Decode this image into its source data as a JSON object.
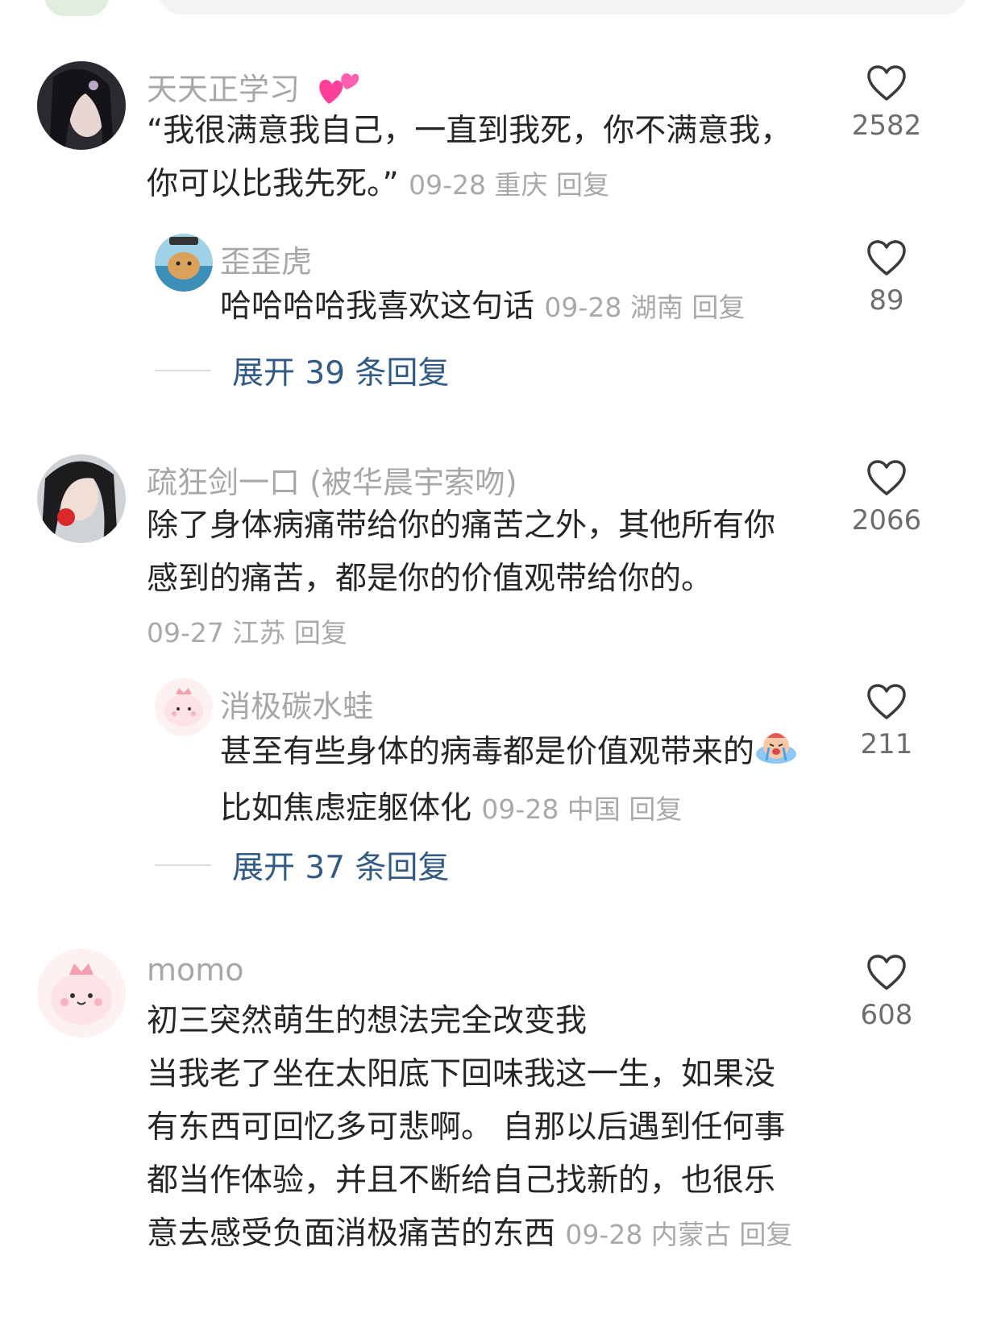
{
  "comments": [
    {
      "username": "天天正学习",
      "text_lines": [
        "“我很满意我自己，一直到我死，你不满意我，",
        "你可以比我先死。”"
      ],
      "date": "09-28",
      "location": "重庆",
      "reply_label": "回复",
      "likes": "2582",
      "sub_reply": {
        "username": "歪歪虎",
        "text": "哈哈哈哈我喜欢这句话",
        "date": "09-28",
        "location": "湖南",
        "reply_label": "回复",
        "likes": "89"
      },
      "expand_label": "展开 39 条回复"
    },
    {
      "username": "疏狂剑一口 (被华晨宇索吻)",
      "text_lines": [
        "除了身体病痛带给你的痛苦之外，其他所有你",
        "感到的痛苦，都是你的价值观带给你的。"
      ],
      "date": "09-27",
      "location": "江苏",
      "reply_label": "回复",
      "likes": "2066",
      "sub_reply": {
        "username": "消极碳水蛙",
        "text_line1": "甚至有些身体的病毒都是价值观带来的",
        "text_line2": "比如焦虑症躯体化",
        "date": "09-28",
        "location": "中国",
        "reply_label": "回复",
        "likes": "211"
      },
      "expand_label": "展开 37 条回复"
    },
    {
      "username": "momo",
      "text_lines": [
        "初三突然萌生的想法完全改变我",
        "当我老了坐在太阳底下回味我这一生，如果没",
        "有东西可回忆多可悲啊。 自那以后遇到任何事",
        "都当作体验，并且不断给自己找新的，也很乐",
        "意去感受负面消极痛苦的东西"
      ],
      "date": "09-28",
      "location": "内蒙古",
      "reply_label": "回复",
      "likes": "608"
    }
  ],
  "icons": {
    "like": "heart-outline-icon",
    "emoji1": "two-hearts-emoji",
    "emoji2": "crying-emoji"
  },
  "colors": {
    "link": "#315a85",
    "meta": "#a9a9a9",
    "username": "#a7a7a7",
    "text": "#262626"
  }
}
